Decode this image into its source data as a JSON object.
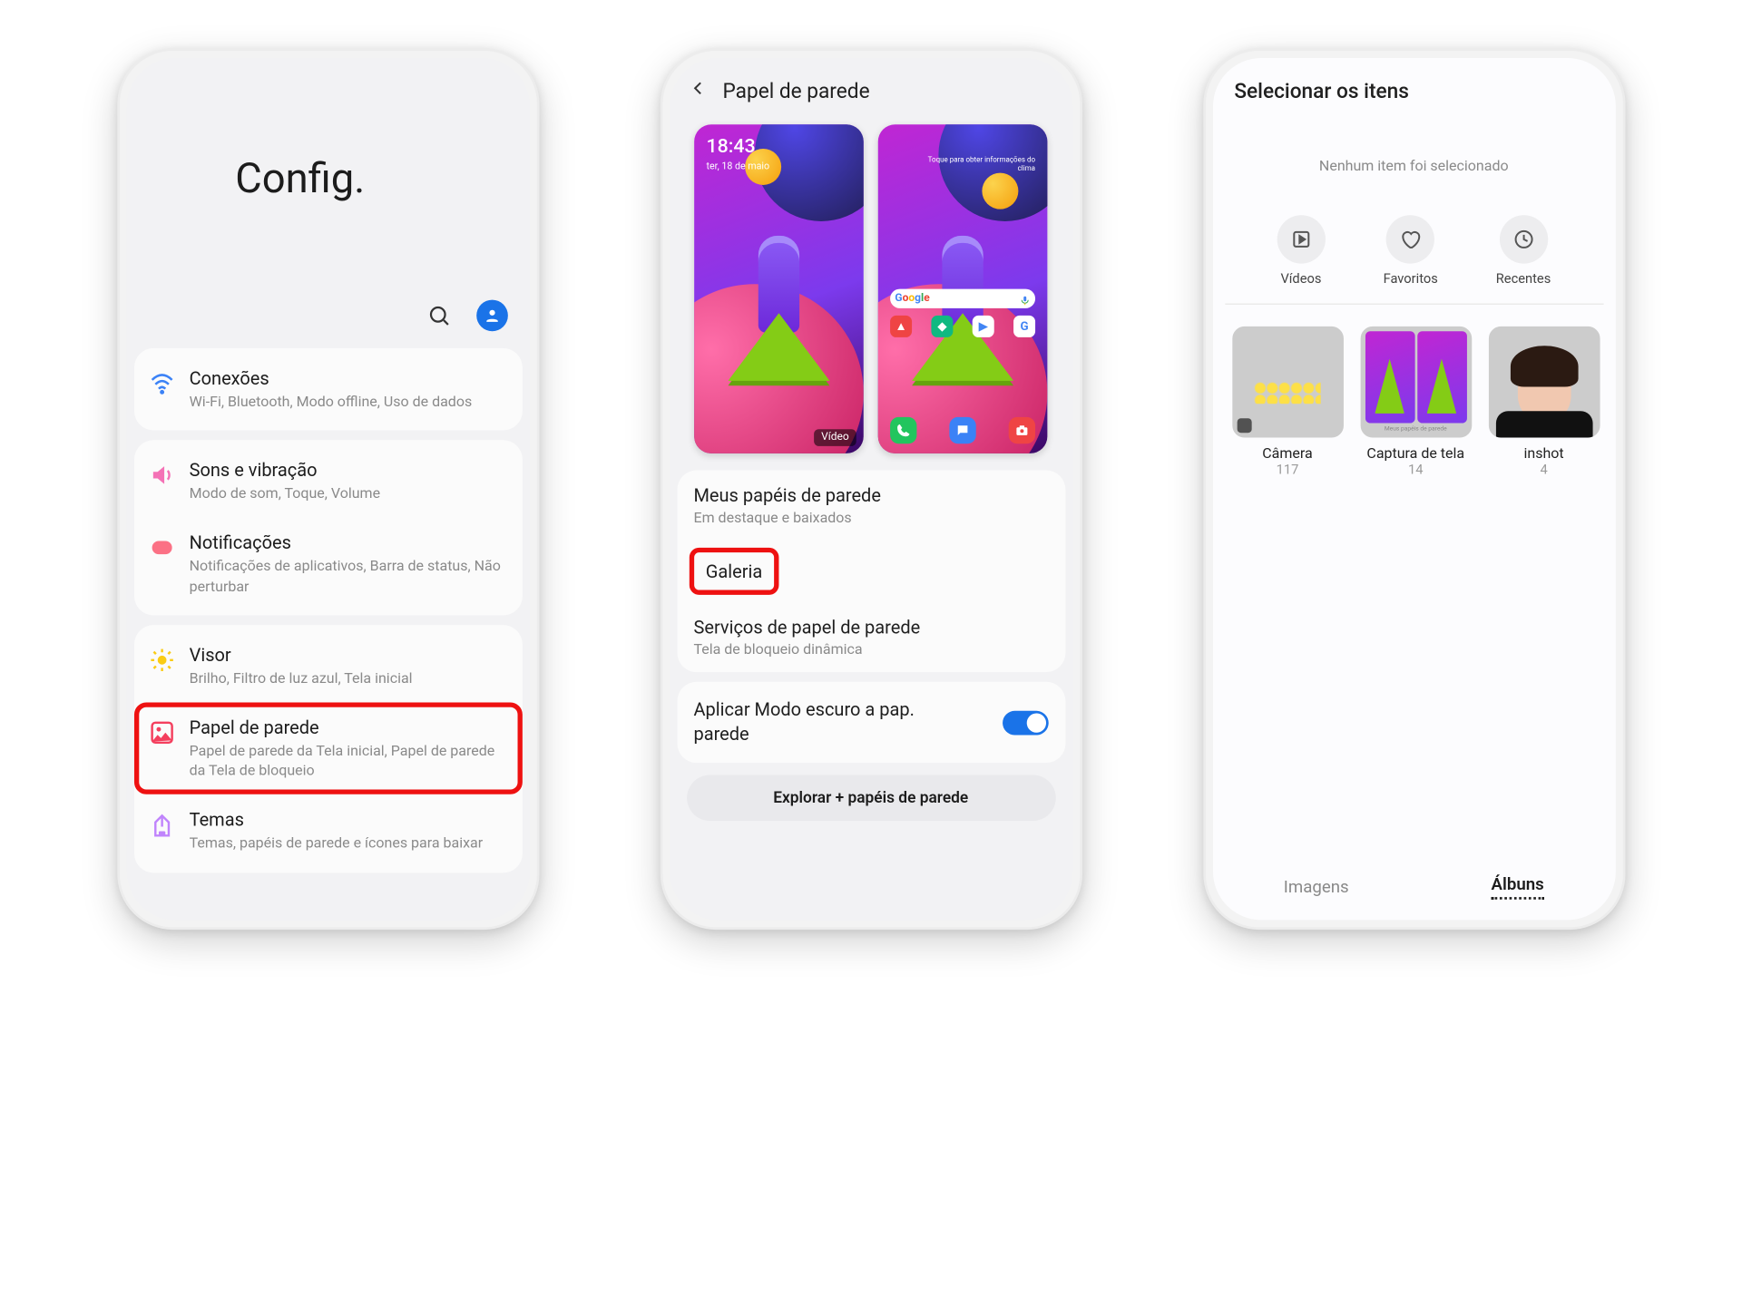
{
  "phone1": {
    "header": "Config.",
    "items": {
      "connections": {
        "title": "Conexões",
        "sub": "Wi-Fi, Bluetooth, Modo offline, Uso de dados"
      },
      "sounds": {
        "title": "Sons e vibração",
        "sub": "Modo de som, Toque, Volume"
      },
      "notifications": {
        "title": "Notificações",
        "sub": "Notificações de aplicativos, Barra de status, Não perturbar"
      },
      "display": {
        "title": "Visor",
        "sub": "Brilho, Filtro de luz azul, Tela inicial"
      },
      "wallpaper": {
        "title": "Papel de parede",
        "sub": "Papel de parede da Tela inicial, Papel de parede da Tela de bloqueio"
      },
      "themes": {
        "title": "Temas",
        "sub": "Temas, papéis de parede e ícones para baixar"
      }
    }
  },
  "phone2": {
    "title": "Papel de parede",
    "lock": {
      "time": "18:43",
      "date": "ter, 18 de maio"
    },
    "home_hint": "Toque para obter informações do clima",
    "video_tag": "Vídeo",
    "rows": {
      "my_wallpapers": {
        "title": "Meus papéis de parede",
        "sub": "Em destaque e baixados"
      },
      "gallery": {
        "title": "Galeria"
      },
      "services": {
        "title": "Serviços de papel de parede",
        "sub": "Tela de bloqueio dinâmica"
      }
    },
    "dark_mode": "Aplicar Modo escuro a pap. parede",
    "explore": "Explorar + papéis de parede"
  },
  "phone3": {
    "title": "Selecionar os itens",
    "empty": "Nenhum item foi selecionado",
    "filters": {
      "videos": "Vídeos",
      "favorites": "Favoritos",
      "recents": "Recentes"
    },
    "albums": {
      "camera": {
        "label": "Câmera",
        "count": "117"
      },
      "screens": {
        "label": "Captura de tela",
        "count": "14",
        "thumb_caption": "Meus papéis de parede"
      },
      "inshot": {
        "label": "inshot",
        "count": "4"
      }
    },
    "tabs": {
      "images": "Imagens",
      "albums": "Álbuns"
    }
  }
}
